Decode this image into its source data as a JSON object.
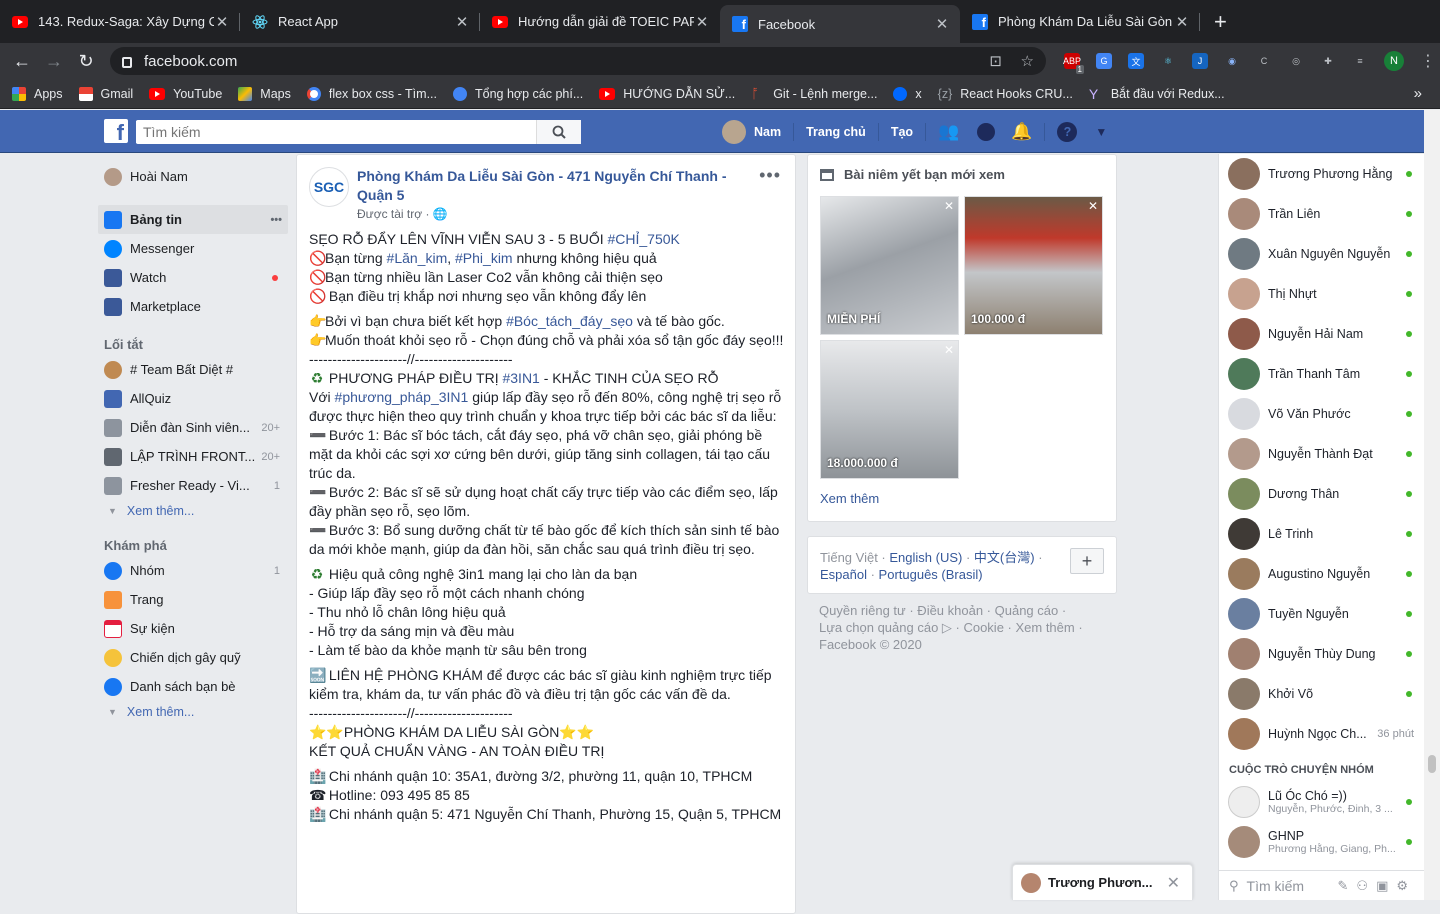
{
  "browser": {
    "tabs": [
      {
        "title": "143. Redux-Saga: Xây Dựng Cl",
        "icon": "youtube-icon"
      },
      {
        "title": "React App",
        "icon": "react-icon"
      },
      {
        "title": "Hướng dẫn giải đề TOEIC PART",
        "icon": "youtube-icon"
      },
      {
        "title": "Facebook",
        "icon": "facebook-icon"
      },
      {
        "title": "Phòng Khám Da Liễu Sài Gòn -",
        "icon": "facebook-icon"
      }
    ],
    "url": "facebook.com",
    "profile_initial": "N",
    "ext_badge": "1",
    "bookmarks": [
      "Apps",
      "Gmail",
      "YouTube",
      "Maps",
      "flex box css - Tìm...",
      "Tổng hợp các phí...",
      "HƯỚNG DẪN SỬ...",
      "Git - Lệnh merge...",
      "x",
      "React Hooks CRU...",
      "Bắt đầu với Redux..."
    ],
    "bookmark_prefix": "{z}",
    "overflow": "»"
  },
  "fb": {
    "search_placeholder": "Tìm kiếm",
    "user": "Nam",
    "nav_home": "Trang chủ",
    "nav_create": "Tạo"
  },
  "left": {
    "profile": "Hoài Nam",
    "main": [
      {
        "label": "Bảng tin",
        "extra": "•••"
      },
      {
        "label": "Messenger"
      },
      {
        "label": "Watch"
      },
      {
        "label": "Marketplace"
      }
    ],
    "shortcuts_title": "Lối tắt",
    "shortcuts": [
      {
        "label": "# Team Bất Diệt #",
        "count": ""
      },
      {
        "label": "AllQuiz",
        "count": ""
      },
      {
        "label": "Diễn đàn Sinh viên...",
        "count": "20+"
      },
      {
        "label": "LẬP TRÌNH FRONT...",
        "count": "20+"
      },
      {
        "label": "Fresher Ready - Vi...",
        "count": "1"
      }
    ],
    "see_more": "Xem thêm...",
    "explore_title": "Khám phá",
    "explore": [
      {
        "label": "Nhóm",
        "count": "1"
      },
      {
        "label": "Trang",
        "count": ""
      },
      {
        "label": "Sự kiện",
        "count": ""
      },
      {
        "label": "Chiến dịch gây quỹ",
        "count": ""
      },
      {
        "label": "Danh sách bạn bè",
        "count": ""
      }
    ],
    "see_more2": "Xem thêm..."
  },
  "post": {
    "logo": "SGC",
    "page_name": "Phòng Khám Da Liễu Sài Gòn - 471 Nguyễn Chí Thanh - Quận 5",
    "sponsored": "Được tài trợ ·",
    "menu": "•••",
    "l1a": "SẸO RỖ ĐẨY LÊN VĨNH VIỄN SAU 3 - 5 BUỔI ",
    "l1tag": "#CHỈ_750K",
    "l2a": "Bạn từng ",
    "l2tag1": "#Lăn_kim",
    "l2b": ", ",
    "l2tag2": "#Phi_kim",
    "l2c": " nhưng không hiệu quả",
    "l3": "Bạn từng nhiều lần Laser Co2 vẫn không cải thiện sẹo",
    "l4": "Bạn điều trị khắp nơi nhưng sẹo vẫn không đẩy lên",
    "l5a": "Bởi vì bạn chưa biết kết hợp ",
    "l5tag": "#Bóc_tách_đáy_sẹo",
    "l5b": " và tế bào gốc.",
    "l6": "Muốn thoát khỏi sẹo rỗ - Chọn đúng chỗ và phải xóa sổ tận gốc đáy sẹo!!!",
    "divider": "---------------------//---------------------",
    "l7a": "PHƯƠNG PHÁP ĐIỀU TRỊ ",
    "l7tag": "#3IN1",
    "l7b": " - KHẮC TINH CỦA SẸO RỖ",
    "l8a": "Với ",
    "l8tag": "#phương_pháp_3IN1",
    "l8b": " giúp lấp đầy sẹo rỗ đến 80%, công nghệ trị sẹo rỗ được thực hiện theo quy trình chuẩn y khoa trực tiếp bởi các bác sĩ da liễu:",
    "step1": "Bước 1: Bác sĩ bóc tách, cắt đáy sẹo, phá vỡ chân sẹo, giải phóng bề mặt da khỏi các sợi xơ cứng bên dưới, giúp tăng sinh collagen, tái tạo cấu trúc da.",
    "step2": "Bước 2: Bác sĩ sẽ sử dụng hoạt chất cấy trực tiếp vào các điểm sẹo, lấp đầy phần sẹo rỗ, sẹo lõm.",
    "step3": "Bước 3: Bổ sung dưỡng chất từ tế bào gốc để kích thích sản sinh tế bào da mới khỏe mạnh, giúp da đàn hồi, săn chắc sau quá trình điều trị sẹo.",
    "eff": "Hiệu quả công nghệ 3in1 mang lại cho làn da bạn",
    "b1": "- Giúp lấp đầy sẹo rỗ một cách nhanh chóng",
    "b2": "- Thu nhỏ lỗ chân lông hiệu quả",
    "b3": "- Hỗ trợ da sáng mịn và đều màu",
    "b4": "- Làm tế bào da khỏe mạnh từ sâu bên trong",
    "contact": "LIÊN HỆ PHÒNG KHÁM để được các bác sĩ giàu kinh nghiệm trực tiếp kiểm tra, khám da, tư vấn phác đồ và điều trị tận gốc các vấn đề da.",
    "clinic": "PHÒNG KHÁM DA LIỄU SÀI GÒN",
    "result": "KẾT QUẢ CHUẨN VÀNG - AN TOÀN ĐIỀU TRỊ",
    "branch10": "Chi nhánh quận 10: 35A1, đường 3/2, phường 11, quận 10, TPHCM",
    "hotline": "Hotline: 093 495 85 85",
    "branch5": "Chi nhánh quận 5: 471 Nguyễn Chí Thanh, Phường 15, Quận 5, TPHCM"
  },
  "marketplace": {
    "title": "Bài niêm yết bạn mới xem",
    "items": [
      {
        "price": "MIỄN PHÍ"
      },
      {
        "price": "100.000 đ"
      },
      {
        "price": "18.000.000 đ"
      }
    ],
    "see_more": "Xem thêm"
  },
  "languages": {
    "current": "Tiếng Việt ·",
    "l1": "English (US)",
    "l2": "中文(台灣)",
    "l3": "Español",
    "l4": "Português (Brasil)",
    "add": "+"
  },
  "footer": {
    "line1": "Quyền riêng tư · Điều khoản · Quảng cáo ·",
    "line2": "Lựa chọn quảng cáo ▷ · Cookie · Xem thêm ·",
    "line3": "Facebook © 2020"
  },
  "chat": {
    "contacts": [
      {
        "name": "Trương Phương Hằng",
        "status": "online"
      },
      {
        "name": "Trần Liên",
        "status": "online"
      },
      {
        "name": "Xuân Nguyên Nguyễn",
        "status": "online"
      },
      {
        "name": "Thị Nhựt",
        "status": "online"
      },
      {
        "name": "Nguyễn Hải Nam",
        "status": "online"
      },
      {
        "name": "Trần Thanh Tâm",
        "status": "online"
      },
      {
        "name": "Võ Văn Phước",
        "status": "online"
      },
      {
        "name": "Nguyễn Thành Đạt",
        "status": "online"
      },
      {
        "name": "Dương Thân",
        "status": "online"
      },
      {
        "name": "Lê Trinh",
        "status": "online"
      },
      {
        "name": "Augustino Nguyễn",
        "status": "online"
      },
      {
        "name": "Tuyền Nguyễn",
        "status": "online"
      },
      {
        "name": "Nguyễn Thùy Dung",
        "status": "online"
      },
      {
        "name": "Khởi Võ",
        "status": "online"
      },
      {
        "name": "Huỳnh Ngọc Ch...",
        "status": "36 phút"
      }
    ],
    "groups_title": "CUỘC TRÒ CHUYỆN NHÓM",
    "groups": [
      {
        "name": "Lũ Óc Chó =))",
        "members": "Nguyễn, Phước, Đinh, 3 ..."
      },
      {
        "name": "GHNP",
        "members": "Phương Hằng, Giang, Ph..."
      }
    ],
    "search": "Tìm kiếm",
    "open_tab": "Trương Phươn..."
  },
  "colors": {
    "fb_blue": "#4267b2",
    "online": "#42b72a",
    "link": "#385898"
  }
}
